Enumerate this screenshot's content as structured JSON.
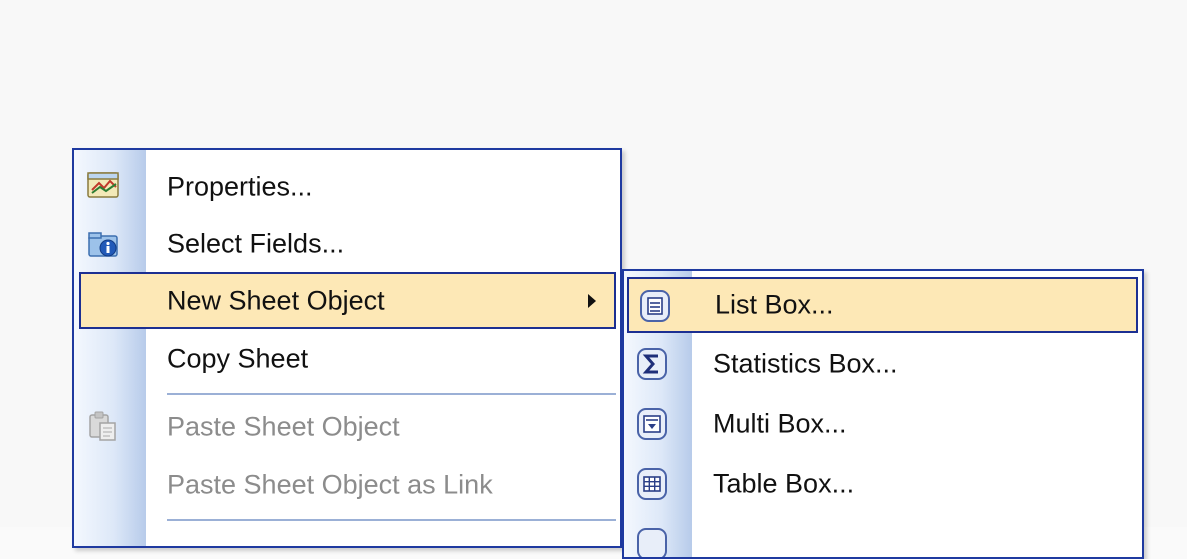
{
  "context_menu": {
    "items": [
      {
        "label": "Properties...",
        "icon": "properties-icon",
        "enabled": true
      },
      {
        "label": "Select Fields...",
        "icon": "select-fields-icon",
        "enabled": true
      },
      {
        "label": "New Sheet Object",
        "icon": "",
        "enabled": true,
        "highlighted": true,
        "has_submenu": true
      },
      {
        "label": "Copy Sheet",
        "icon": "",
        "enabled": true
      },
      {
        "label": "Paste Sheet Object",
        "icon": "paste-icon",
        "enabled": false
      },
      {
        "label": "Paste Sheet Object as Link",
        "icon": "",
        "enabled": false
      }
    ]
  },
  "submenu": {
    "items": [
      {
        "label": "List Box...",
        "icon": "list-box-icon",
        "highlighted": true
      },
      {
        "label": "Statistics Box...",
        "icon": "sigma-icon"
      },
      {
        "label": "Multi Box...",
        "icon": "multi-box-icon"
      },
      {
        "label": "Table Box...",
        "icon": "table-box-icon"
      }
    ]
  },
  "colors": {
    "menu_border": "#1f3aa0",
    "highlight_fill": "#fde8b6",
    "highlight_border": "#1c2f92",
    "gutter_light": "#f4f8fe",
    "gutter_dark": "#b7cbea",
    "disabled_text": "#8c8c8c"
  }
}
